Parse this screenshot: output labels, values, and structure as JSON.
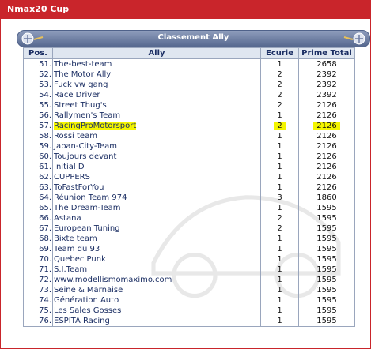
{
  "window": {
    "title": "Nmax20 Cup"
  },
  "panel": {
    "title": "Classement Ally"
  },
  "colors": {
    "title_bar": "#c9252b",
    "header": "#6e7fa4",
    "highlight": "#f4f500",
    "text": "#1b2e63"
  },
  "table": {
    "columns": [
      "Pos.",
      "Ally",
      "Ecurie",
      "Prime Total"
    ],
    "rows": [
      {
        "pos": "51.",
        "ally": "The-best-team",
        "ecurie": "1",
        "prime": "2658"
      },
      {
        "pos": "52.",
        "ally": "The Motor Ally",
        "ecurie": "2",
        "prime": "2392"
      },
      {
        "pos": "53.",
        "ally": "Fuck vw gang",
        "ecurie": "2",
        "prime": "2392"
      },
      {
        "pos": "54.",
        "ally": "Race Driver",
        "ecurie": "2",
        "prime": "2392"
      },
      {
        "pos": "55.",
        "ally": "Street Thug's",
        "ecurie": "2",
        "prime": "2126"
      },
      {
        "pos": "56.",
        "ally": "Rallymen's Team",
        "ecurie": "1",
        "prime": "2126"
      },
      {
        "pos": "57.",
        "ally": "RacingProMotorsport",
        "ecurie": "2",
        "prime": "2126",
        "highlight": true
      },
      {
        "pos": "58.",
        "ally": "Rossi team",
        "ecurie": "1",
        "prime": "2126"
      },
      {
        "pos": "59.",
        "ally": "Japan-City-Team",
        "ecurie": "1",
        "prime": "2126"
      },
      {
        "pos": "60.",
        "ally": "Toujours devant",
        "ecurie": "1",
        "prime": "2126"
      },
      {
        "pos": "61.",
        "ally": "Initial D",
        "ecurie": "1",
        "prime": "2126"
      },
      {
        "pos": "62.",
        "ally": "CUPPERS",
        "ecurie": "1",
        "prime": "2126"
      },
      {
        "pos": "63.",
        "ally": "ToFastForYou",
        "ecurie": "1",
        "prime": "2126"
      },
      {
        "pos": "64.",
        "ally": "Réunion Team 974",
        "ecurie": "3",
        "prime": "1860"
      },
      {
        "pos": "65.",
        "ally": "The Dream-Team",
        "ecurie": "1",
        "prime": "1595"
      },
      {
        "pos": "66.",
        "ally": "Astana",
        "ecurie": "2",
        "prime": "1595"
      },
      {
        "pos": "67.",
        "ally": "European Tuning",
        "ecurie": "2",
        "prime": "1595"
      },
      {
        "pos": "68.",
        "ally": "Bixte team",
        "ecurie": "1",
        "prime": "1595"
      },
      {
        "pos": "69.",
        "ally": "Team du 93",
        "ecurie": "1",
        "prime": "1595"
      },
      {
        "pos": "70.",
        "ally": "Quebec Punk",
        "ecurie": "1",
        "prime": "1595"
      },
      {
        "pos": "71.",
        "ally": "S.I.Team",
        "ecurie": "1",
        "prime": "1595"
      },
      {
        "pos": "72.",
        "ally": "www.modellismomaximo.com",
        "ecurie": "1",
        "prime": "1595"
      },
      {
        "pos": "73.",
        "ally": "Seine & Marnaise",
        "ecurie": "1",
        "prime": "1595"
      },
      {
        "pos": "74.",
        "ally": "Génération Auto",
        "ecurie": "1",
        "prime": "1595"
      },
      {
        "pos": "75.",
        "ally": "Les Sales Gosses",
        "ecurie": "1",
        "prime": "1595"
      },
      {
        "pos": "76.",
        "ally": "ESPITA Racing",
        "ecurie": "1",
        "prime": "1595"
      }
    ]
  }
}
